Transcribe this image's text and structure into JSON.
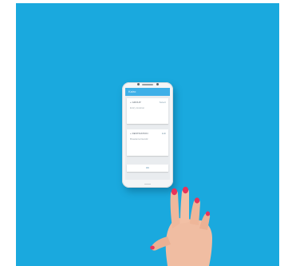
{
  "app": {
    "bar_title": "Kairo"
  },
  "cards": [
    {
      "title": "+ GROUP",
      "action": "Select",
      "subtitle": "Entry location"
    },
    {
      "title": "+ DESTINATION",
      "action": "Edit",
      "subtitle": "Brasileira Decidir"
    }
  ],
  "bottom_button": {
    "label": "OK"
  },
  "colors": {
    "backdrop": "#1aa9de",
    "app_bar": "#3fb0e8",
    "phone_body": "#f4f5f6",
    "skin": "#f0bda2",
    "nail_polish": "#e8335a"
  }
}
